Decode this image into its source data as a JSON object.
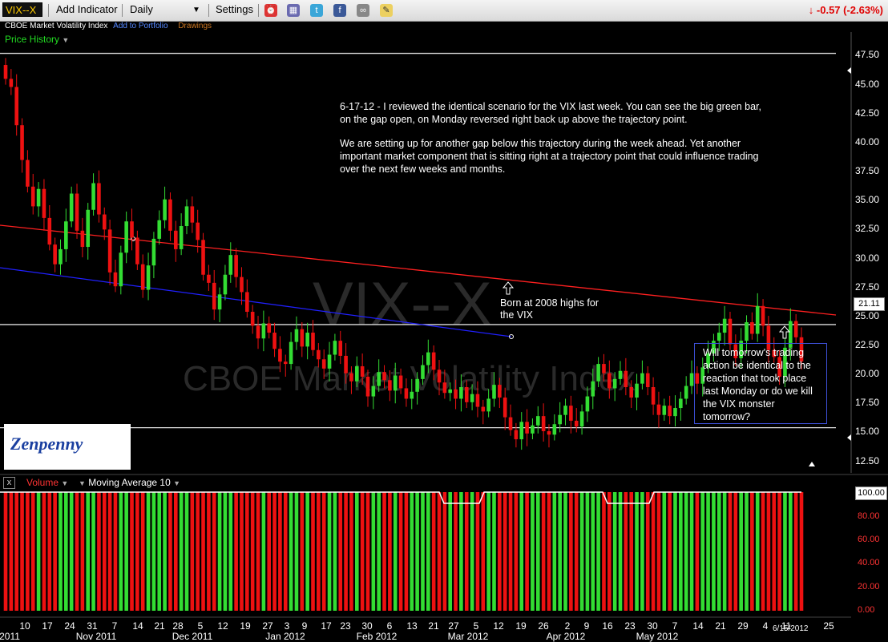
{
  "toolbar": {
    "symbol": "VIX--X",
    "add_indicator": "Add Indicator",
    "period": "Daily",
    "settings": "Settings",
    "change": "-0.57 (-2.63%)",
    "icons": [
      "alarm-clock-icon",
      "print-icon",
      "twitter-icon",
      "facebook-icon",
      "link-icon",
      "note-icon"
    ]
  },
  "subheader": {
    "name": "CBOE Market Volatility Index",
    "add_portfolio": "Add to Portfolio",
    "drawings": "Drawings",
    "price_history": "Price History"
  },
  "annotations": {
    "para1": "6-17-12 - I reviewed the identical scenario for the VIX last week. You can see the big green bar, on the gap open, on Monday reversed right back up above the trajectory point.",
    "para2": "We are setting up for another gap below this trajectory during the week ahead. Yet another important market component that is sitting right at a trajectory point that could influence trading over the next few weeks and months.",
    "born": "Born at 2008 highs for the VIX",
    "question": "Will tomorrow's trading action be identical to the reaction that took place last Monday or do we kill the VIX monster tomorrow?",
    "watermark_symbol": "VIX--X",
    "watermark_name": "CBOE Market Volatility Index",
    "logo": "Zenpenny"
  },
  "volume_panel": {
    "label": "Volume",
    "ma": "Moving Average 10",
    "current": "100.00",
    "ticks": [
      "80.00",
      "60.00",
      "40.00",
      "20.00",
      "0.00"
    ]
  },
  "colors": {
    "up": "#33dd33",
    "down": "#ee1111",
    "red_line": "#ff2020",
    "blue_line": "#2020ff",
    "hline": "#dddddd"
  },
  "chart_data": {
    "type": "candlestick",
    "current_price": "21.11",
    "ylim": [
      11.5,
      48.5
    ],
    "y_ticks": [
      "47.50",
      "45.00",
      "42.50",
      "40.00",
      "37.50",
      "35.00",
      "32.50",
      "30.00",
      "27.50",
      "25.00",
      "22.50",
      "20.00",
      "17.50",
      "15.00",
      "12.50"
    ],
    "x_ticks": [
      "10",
      "17",
      "24",
      "31",
      "7",
      "14",
      "21",
      "28",
      "5",
      "12",
      "19",
      "27",
      "3",
      "9",
      "17",
      "23",
      "30",
      "6",
      "13",
      "21",
      "27",
      "5",
      "12",
      "19",
      "26",
      "2",
      "9",
      "16",
      "23",
      "30",
      "7",
      "14",
      "21",
      "29",
      "4",
      "11",
      "25"
    ],
    "x_months": [
      "2011",
      "Nov 2011",
      "Dec 2011",
      "Jan 2012",
      "Feb 2012",
      "Mar 2012",
      "Apr 2012",
      "May 2012"
    ],
    "last_date": "6/15/2012",
    "horizontal_lines": [
      47.7,
      24.3,
      15.4
    ],
    "closes": [
      45.5,
      44.8,
      41.5,
      38.5,
      36.2,
      34.5,
      36.0,
      33.5,
      31.2,
      29.5,
      30.8,
      33.2,
      35.6,
      32.4,
      31.0,
      34.2,
      36.5,
      33.8,
      32.5,
      28.8,
      27.6,
      30.5,
      33.2,
      31.8,
      29.5,
      27.3,
      29.4,
      31.7,
      33.3,
      35.1,
      32.4,
      30.8,
      32.8,
      34.5,
      33.1,
      31.6,
      28.6,
      27.9,
      25.6,
      26.9,
      28.6,
      30.3,
      28.4,
      27.1,
      25.4,
      24.2,
      23.1,
      24.4,
      23.6,
      22.2,
      21.1,
      20.9,
      22.8,
      23.9,
      22.4,
      23.6,
      22.1,
      21.3,
      20.5,
      21.7,
      22.9,
      21.6,
      20.1,
      19.4,
      20.7,
      19.8,
      18.1,
      19.0,
      20.2,
      19.5,
      18.6,
      19.9,
      18.8,
      17.9,
      18.5,
      19.6,
      20.8,
      21.9,
      20.4,
      19.3,
      18.4,
      18.7,
      17.9,
      18.9,
      17.6,
      18.3,
      17.2,
      16.8,
      17.9,
      19.1,
      18.0,
      16.3,
      15.2,
      14.4,
      15.9,
      14.9,
      15.6,
      16.4,
      15.1,
      14.8,
      15.7,
      16.5,
      17.3,
      16.0,
      15.5,
      16.8,
      18.1,
      19.4,
      20.9,
      20.1,
      18.8,
      19.6,
      20.3,
      18.9,
      18.0,
      19.2,
      20.1,
      18.9,
      17.4,
      16.5,
      17.3,
      16.4,
      17.1,
      17.9,
      19.0,
      20.1,
      19.2,
      20.6,
      21.8,
      22.9,
      23.6,
      24.8,
      22.6,
      21.4,
      22.9,
      24.5,
      23.5,
      25.9,
      24.2,
      22.1,
      21.5,
      19.8,
      22.3,
      24.6,
      23.2,
      21.11
    ]
  }
}
